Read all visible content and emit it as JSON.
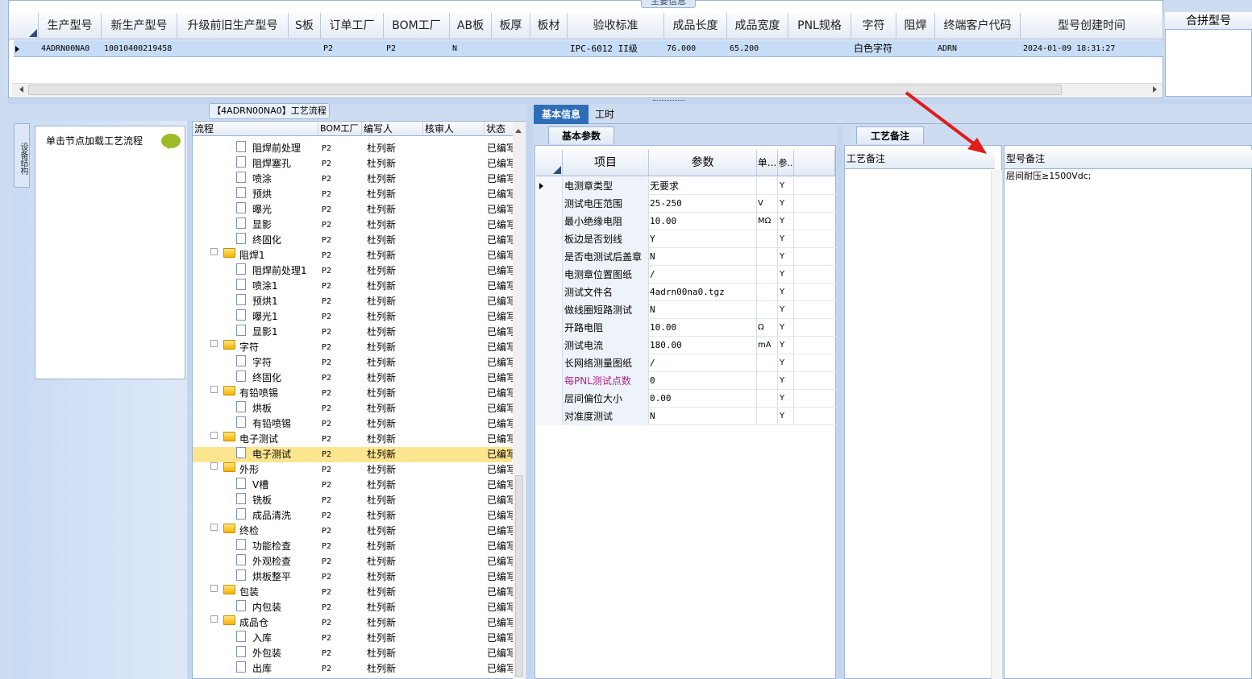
{
  "top": {
    "caption": "主要信息",
    "columns": [
      "生产型号",
      "新生产型号",
      "升级前旧生产型号",
      "S板",
      "订单工厂",
      "BOM工厂",
      "AB板",
      "板厚",
      "板材",
      "验收标准",
      "成品长度",
      "成品宽度",
      "PNL规格",
      "字符",
      "阻焊",
      "终端客户代码",
      "型号创建时间"
    ],
    "right_header": "合拼型号",
    "row": {
      "model": "4ADRN00NA0",
      "new_model": "10010400219458",
      "order_factory": "P2",
      "bom_factory": "P2",
      "ab": "N",
      "standard": "IPC-6012 II级",
      "length": "76.000",
      "width": "65.200",
      "char": "白色字符",
      "customer": "ADRN",
      "created": "2024-01-09 18:31:27"
    }
  },
  "left": {
    "vtab": "设备结构",
    "hint": "单击节点加载工艺流程"
  },
  "process": {
    "caption": "【4ADRN00NA0】工艺流程",
    "headers": [
      "流程",
      "BOM工厂",
      "编写人",
      "核审人",
      "状态"
    ],
    "rows": [
      {
        "name": "阻焊前处理",
        "type": "doc",
        "bom": "P2",
        "writer": "杜列新",
        "status": "已编写"
      },
      {
        "name": "阻焊塞孔",
        "type": "doc",
        "bom": "P2",
        "writer": "杜列新",
        "status": "已编写"
      },
      {
        "name": "喷涂",
        "type": "doc",
        "bom": "P2",
        "writer": "杜列新",
        "status": "已编写"
      },
      {
        "name": "预烘",
        "type": "doc",
        "bom": "P2",
        "writer": "杜列新",
        "status": "已编写"
      },
      {
        "name": "曝光",
        "type": "doc",
        "bom": "P2",
        "writer": "杜列新",
        "status": "已编写"
      },
      {
        "name": "显影",
        "type": "doc",
        "bom": "P2",
        "writer": "杜列新",
        "status": "已编写"
      },
      {
        "name": "终固化",
        "type": "doc",
        "bom": "P2",
        "writer": "杜列新",
        "status": "已编写"
      },
      {
        "name": "阻焊1",
        "type": "folder",
        "bom": "P2",
        "writer": "杜列新",
        "status": "已编写"
      },
      {
        "name": "阻焊前处理1",
        "type": "doc",
        "bom": "P2",
        "writer": "杜列新",
        "status": "已编写"
      },
      {
        "name": "喷涂1",
        "type": "doc",
        "bom": "P2",
        "writer": "杜列新",
        "status": "已编写"
      },
      {
        "name": "预烘1",
        "type": "doc",
        "bom": "P2",
        "writer": "杜列新",
        "status": "已编写"
      },
      {
        "name": "曝光1",
        "type": "doc",
        "bom": "P2",
        "writer": "杜列新",
        "status": "已编写"
      },
      {
        "name": "显影1",
        "type": "doc",
        "bom": "P2",
        "writer": "杜列新",
        "status": "已编写"
      },
      {
        "name": "字符",
        "type": "folder",
        "bom": "P2",
        "writer": "杜列新",
        "status": "已编写"
      },
      {
        "name": "字符",
        "type": "doc",
        "bom": "P2",
        "writer": "杜列新",
        "status": "已编写"
      },
      {
        "name": "终固化",
        "type": "doc",
        "bom": "P2",
        "writer": "杜列新",
        "status": "已编写"
      },
      {
        "name": "有铅喷锡",
        "type": "folder",
        "bom": "P2",
        "writer": "杜列新",
        "status": "已编写"
      },
      {
        "name": "烘板",
        "type": "doc",
        "bom": "P2",
        "writer": "杜列新",
        "status": "已编写"
      },
      {
        "name": "有铅喷锡",
        "type": "doc",
        "bom": "P2",
        "writer": "杜列新",
        "status": "已编写"
      },
      {
        "name": "电子测试",
        "type": "folder",
        "bom": "P2",
        "writer": "杜列新",
        "status": "已编写"
      },
      {
        "name": "电子测试",
        "type": "doc",
        "bom": "P2",
        "writer": "杜列新",
        "status": "已编写",
        "selected": true
      },
      {
        "name": "外形",
        "type": "folder",
        "bom": "P2",
        "writer": "杜列新",
        "status": "已编写"
      },
      {
        "name": "V槽",
        "type": "doc",
        "bom": "P2",
        "writer": "杜列新",
        "status": "已编写"
      },
      {
        "name": "铣板",
        "type": "doc",
        "bom": "P2",
        "writer": "杜列新",
        "status": "已编写"
      },
      {
        "name": "成品清洗",
        "type": "doc",
        "bom": "P2",
        "writer": "杜列新",
        "status": "已编写"
      },
      {
        "name": "终检",
        "type": "folder",
        "bom": "P2",
        "writer": "杜列新",
        "status": "已编写"
      },
      {
        "name": "功能检查",
        "type": "doc",
        "bom": "P2",
        "writer": "杜列新",
        "status": "已编写"
      },
      {
        "name": "外观检查",
        "type": "doc",
        "bom": "P2",
        "writer": "杜列新",
        "status": "已编写"
      },
      {
        "name": "烘板整平",
        "type": "doc",
        "bom": "P2",
        "writer": "杜列新",
        "status": "已编写"
      },
      {
        "name": "包装",
        "type": "folder",
        "bom": "P2",
        "writer": "杜列新",
        "status": "已编写"
      },
      {
        "name": "内包装",
        "type": "doc",
        "bom": "P2",
        "writer": "杜列新",
        "status": "已编写"
      },
      {
        "name": "成品仓",
        "type": "folder",
        "bom": "P2",
        "writer": "杜列新",
        "status": "已编写"
      },
      {
        "name": "入库",
        "type": "doc",
        "bom": "P2",
        "writer": "杜列新",
        "status": "已编写"
      },
      {
        "name": "外包装",
        "type": "doc",
        "bom": "P2",
        "writer": "杜列新",
        "status": "已编写"
      },
      {
        "name": "出库",
        "type": "doc",
        "bom": "P2",
        "writer": "杜列新",
        "status": "已编写"
      }
    ]
  },
  "tabs": {
    "basic": "基本信息",
    "hours": "工时"
  },
  "params": {
    "subtab": "基本参数",
    "headers": [
      "项目",
      "参数",
      "单...",
      "参.."
    ],
    "rows": [
      {
        "k": "电测章类型",
        "v": "无要求",
        "u": "",
        "y": "Y"
      },
      {
        "k": "测试电压范围",
        "v": "25-250",
        "u": "V",
        "y": "Y"
      },
      {
        "k": "最小绝缘电阻",
        "v": "10.00",
        "u": "MΩ",
        "y": "Y"
      },
      {
        "k": "板边是否划线",
        "v": "Y",
        "u": "",
        "y": "Y"
      },
      {
        "k": "是否电测试后盖章",
        "v": "N",
        "u": "",
        "y": "Y"
      },
      {
        "k": "电测章位置图纸",
        "v": "/",
        "u": "",
        "y": "Y"
      },
      {
        "k": "测试文件名",
        "v": "4adrn00na0.tgz",
        "u": "",
        "y": "Y"
      },
      {
        "k": "做线圈短路测试",
        "v": "N",
        "u": "",
        "y": "Y"
      },
      {
        "k": "开路电阻",
        "v": "10.00",
        "u": "Ω",
        "y": "Y"
      },
      {
        "k": "测试电流",
        "v": "180.00",
        "u": "mA",
        "y": "Y"
      },
      {
        "k": "长网络测量图纸",
        "v": "/",
        "u": "",
        "y": "Y"
      },
      {
        "k": "每PNL测试点数",
        "v": "0",
        "u": "",
        "y": "Y",
        "highlight": true
      },
      {
        "k": "层间偏位大小",
        "v": "0.00",
        "u": "",
        "y": "Y"
      },
      {
        "k": "对准度测试",
        "v": "N",
        "u": "",
        "y": "Y"
      }
    ]
  },
  "remarks": {
    "tab": "工艺备注",
    "process_header": "工艺备注",
    "model_header": "型号备注",
    "model_text": "层间耐压≥1500Vdc;"
  },
  "colors": {
    "accent": "#2f6db6",
    "selection": "#fde590",
    "arrow": "#e21b1b",
    "highlight_text": "#b0258a"
  }
}
